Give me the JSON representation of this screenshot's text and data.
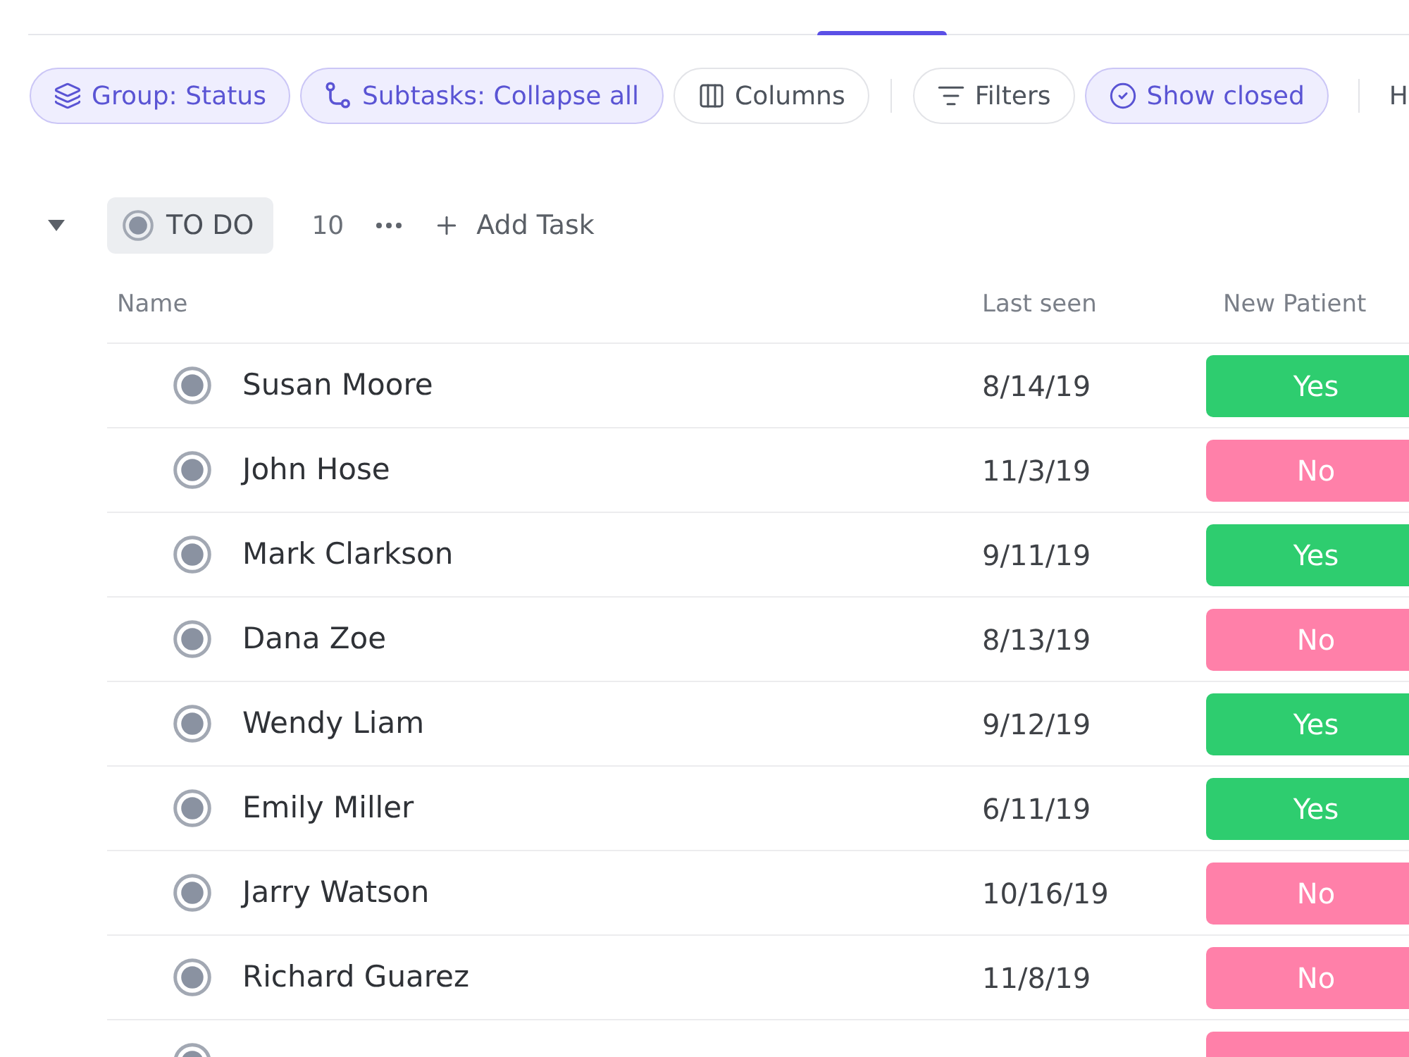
{
  "toolbar": {
    "groups": [
      [
        {
          "label": "Group: Status",
          "active": true
        },
        {
          "label": "Subtasks: Collapse all",
          "active": true
        },
        {
          "label": "Columns",
          "active": false
        }
      ],
      [
        {
          "label": "Filters",
          "active": false
        },
        {
          "label": "Show closed",
          "active": true
        }
      ]
    ],
    "cut_off_label": "H"
  },
  "group": {
    "expanded": true,
    "status": "TO DO",
    "count": "10",
    "add_task": "Add Task"
  },
  "table": {
    "columns": [
      "Name",
      "Last seen",
      "New Patient"
    ],
    "rows": [
      {
        "name": "Susan Moore",
        "last_seen": "8/14/19",
        "new_patient": {
          "label": "Yes",
          "color": "#2ecd6f"
        }
      },
      {
        "name": "John Hose",
        "last_seen": "11/3/19",
        "new_patient": {
          "label": "No",
          "color": "#ff80a9"
        }
      },
      {
        "name": "Mark Clarkson",
        "last_seen": "9/11/19",
        "new_patient": {
          "label": "Yes",
          "color": "#2ecd6f"
        }
      },
      {
        "name": "Dana Zoe",
        "last_seen": "8/13/19",
        "new_patient": {
          "label": "No",
          "color": "#ff80a9"
        }
      },
      {
        "name": "Wendy Liam",
        "last_seen": "9/12/19",
        "new_patient": {
          "label": "Yes",
          "color": "#2ecd6f"
        }
      },
      {
        "name": "Emily Miller",
        "last_seen": "6/11/19",
        "new_patient": {
          "label": "Yes",
          "color": "#2ecd6f"
        }
      },
      {
        "name": "Jarry Watson",
        "last_seen": "10/16/19",
        "new_patient": {
          "label": "No",
          "color": "#ff80a9"
        }
      },
      {
        "name": "Richard Guarez",
        "last_seen": "11/8/19",
        "new_patient": {
          "label": "No",
          "color": "#ff80a9"
        }
      },
      {
        "new_patient": {
          "color": "#ff80a9"
        }
      }
    ]
  }
}
